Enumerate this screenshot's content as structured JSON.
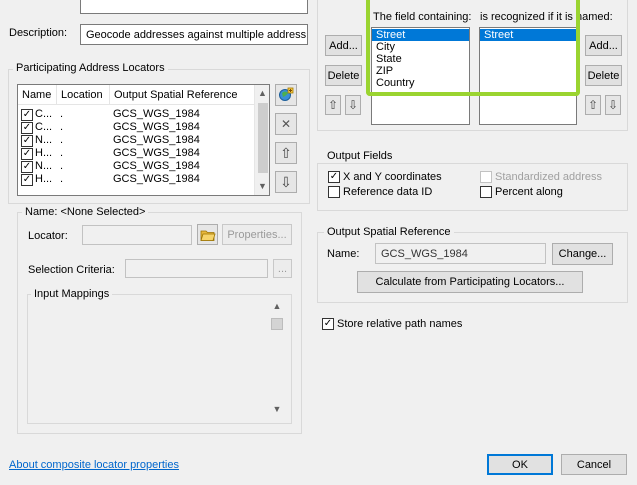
{
  "description": {
    "label": "Description:",
    "value": "Geocode addresses against multiple address locator"
  },
  "locators": {
    "group_title": "Participating Address Locators",
    "columns": [
      "Name",
      "Location",
      "Output Spatial Reference"
    ],
    "rows": [
      {
        "checked": true,
        "name": "C...",
        "location": ".",
        "sr": "GCS_WGS_1984"
      },
      {
        "checked": true,
        "name": "C...",
        "location": ".",
        "sr": "GCS_WGS_1984"
      },
      {
        "checked": true,
        "name": "N...",
        "location": ".",
        "sr": "GCS_WGS_1984"
      },
      {
        "checked": true,
        "name": "H...",
        "location": ".",
        "sr": "GCS_WGS_1984"
      },
      {
        "checked": true,
        "name": "N...",
        "location": ".",
        "sr": "GCS_WGS_1984"
      },
      {
        "checked": true,
        "name": "H...",
        "location": ".",
        "sr": "GCS_WGS_1984"
      }
    ]
  },
  "name_group": {
    "title": "Name: <None Selected>",
    "locator_label": "Locator:",
    "properties_button": "Properties...",
    "selection_label": "Selection Criteria:",
    "ellipsis": "...",
    "input_mappings_title": "Input Mappings"
  },
  "fields": {
    "containing_header": "The field containing:",
    "recognized_header": "is recognized if it is named:",
    "add_label": "Add...",
    "delete_label": "Delete",
    "field_items": [
      "Street",
      "City",
      "State",
      "ZIP",
      "Country"
    ],
    "named_items": [
      "Street"
    ],
    "selected_field": "Street"
  },
  "output_fields": {
    "title": "Output Fields",
    "xy": {
      "label": "X and Y coordinates",
      "checked": true
    },
    "standardized": {
      "label": "Standardized address",
      "checked": false
    },
    "reference_id": {
      "label": "Reference data ID",
      "checked": false
    },
    "percent_along": {
      "label": "Percent along",
      "checked": false
    }
  },
  "output_sr": {
    "title": "Output Spatial Reference",
    "name_label": "Name:",
    "name_value": "GCS_WGS_1984",
    "change_button": "Change...",
    "calculate_button": "Calculate from Participating Locators..."
  },
  "store_relative": {
    "label": "Store relative path names",
    "checked": true
  },
  "footer": {
    "link": "About composite locator properties",
    "ok": "OK",
    "cancel": "Cancel"
  },
  "icons": {
    "checkmark": "✓",
    "up_arrow": "⇧",
    "down_arrow": "⇩",
    "delete_x": "✕",
    "scroll_up": "▲",
    "scroll_down": "▼",
    "folder_icon": "folder-open-icon",
    "add_locator_icon": "add-locator-icon"
  },
  "colors": {
    "selection": "#0078d7",
    "highlight": "#9ad430",
    "link": "#0066cc"
  }
}
